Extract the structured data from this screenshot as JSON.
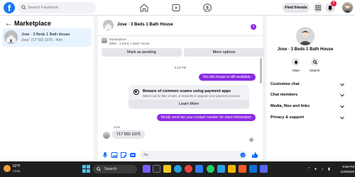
{
  "topbar": {
    "logo_letter": "f",
    "search_placeholder": "Search Facebook",
    "find_friends_label": "Find friends",
    "notification_count": "7",
    "nav_icons": [
      "home-icon",
      "video-icon",
      "groups-icon"
    ]
  },
  "left": {
    "title": "Marketplace",
    "conversation": {
      "name": "Jose · 3 Beds 1 Bath House",
      "preview": "Jose: 717 592 1075 · 40m"
    }
  },
  "chat": {
    "title": "Jose · 3 Beds 1 Bath House",
    "listing_tag": "Marketplace",
    "listing_info": "$900 · 3 Beds 1 Bath House",
    "mark_pending_label": "Mark as pending",
    "more_options_label": "More options",
    "timestamp": "6:19 PM",
    "messages": {
      "out1": "Yes this house is still available.",
      "scam_title": "Beware of common scams using payment apps",
      "scam_text": "Watch out for fake emails or requests to upgrade your payment account.",
      "learn_more_label": "Learn More",
      "out2": "Kindly send me your contact number for more information",
      "in_name": "Jose",
      "in1": "717 592 1075"
    },
    "composer_placeholder": "Aa"
  },
  "right": {
    "title": "Jose · 3 Beds 1 Bath House",
    "mute_label": "Mute",
    "search_label": "Search",
    "rows": [
      "Customize chat",
      "Chat members",
      "Media, files and links",
      "Privacy & support"
    ]
  },
  "taskbar": {
    "temperature": "62°F",
    "condition": "Clear",
    "search_label": "Search",
    "time": "9:58 PM",
    "date": "11/9/2025"
  },
  "colors": {
    "brand": "#1877f2",
    "accent": "#8a2be2",
    "badge": "#e41e3f"
  }
}
